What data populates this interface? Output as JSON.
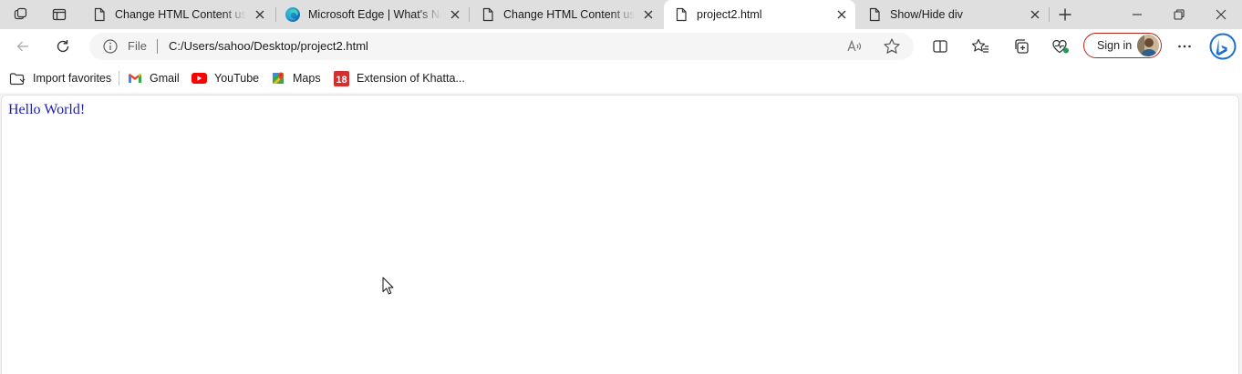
{
  "tabs": [
    {
      "title": "Change HTML Content using",
      "icon": "page-icon",
      "active": false
    },
    {
      "title": "Microsoft Edge | What's New",
      "icon": "edge-icon",
      "active": false
    },
    {
      "title": "Change HTML Content using",
      "icon": "page-icon",
      "active": false
    },
    {
      "title": "project2.html",
      "icon": "page-icon",
      "active": true
    },
    {
      "title": "Show/Hide div",
      "icon": "page-icon",
      "active": false
    }
  ],
  "address": {
    "scheme_label": "File",
    "url": "C:/Users/sahoo/Desktop/project2.html"
  },
  "toolbar": {
    "signin_label": "Sign in"
  },
  "favorites": [
    {
      "label": "Import favorites",
      "icon": "import-favorites-icon"
    },
    {
      "label": "Gmail",
      "icon": "gmail-icon"
    },
    {
      "label": "YouTube",
      "icon": "youtube-icon"
    },
    {
      "label": "Maps",
      "icon": "maps-icon"
    },
    {
      "label": "Extension of Khatta...",
      "icon": "eighteen-icon"
    }
  ],
  "page": {
    "text": "Hello World!"
  },
  "colors": {
    "accent_red": "#b3261e",
    "hello_text": "#1d1db3",
    "edge_blue": "#0c59a4"
  }
}
